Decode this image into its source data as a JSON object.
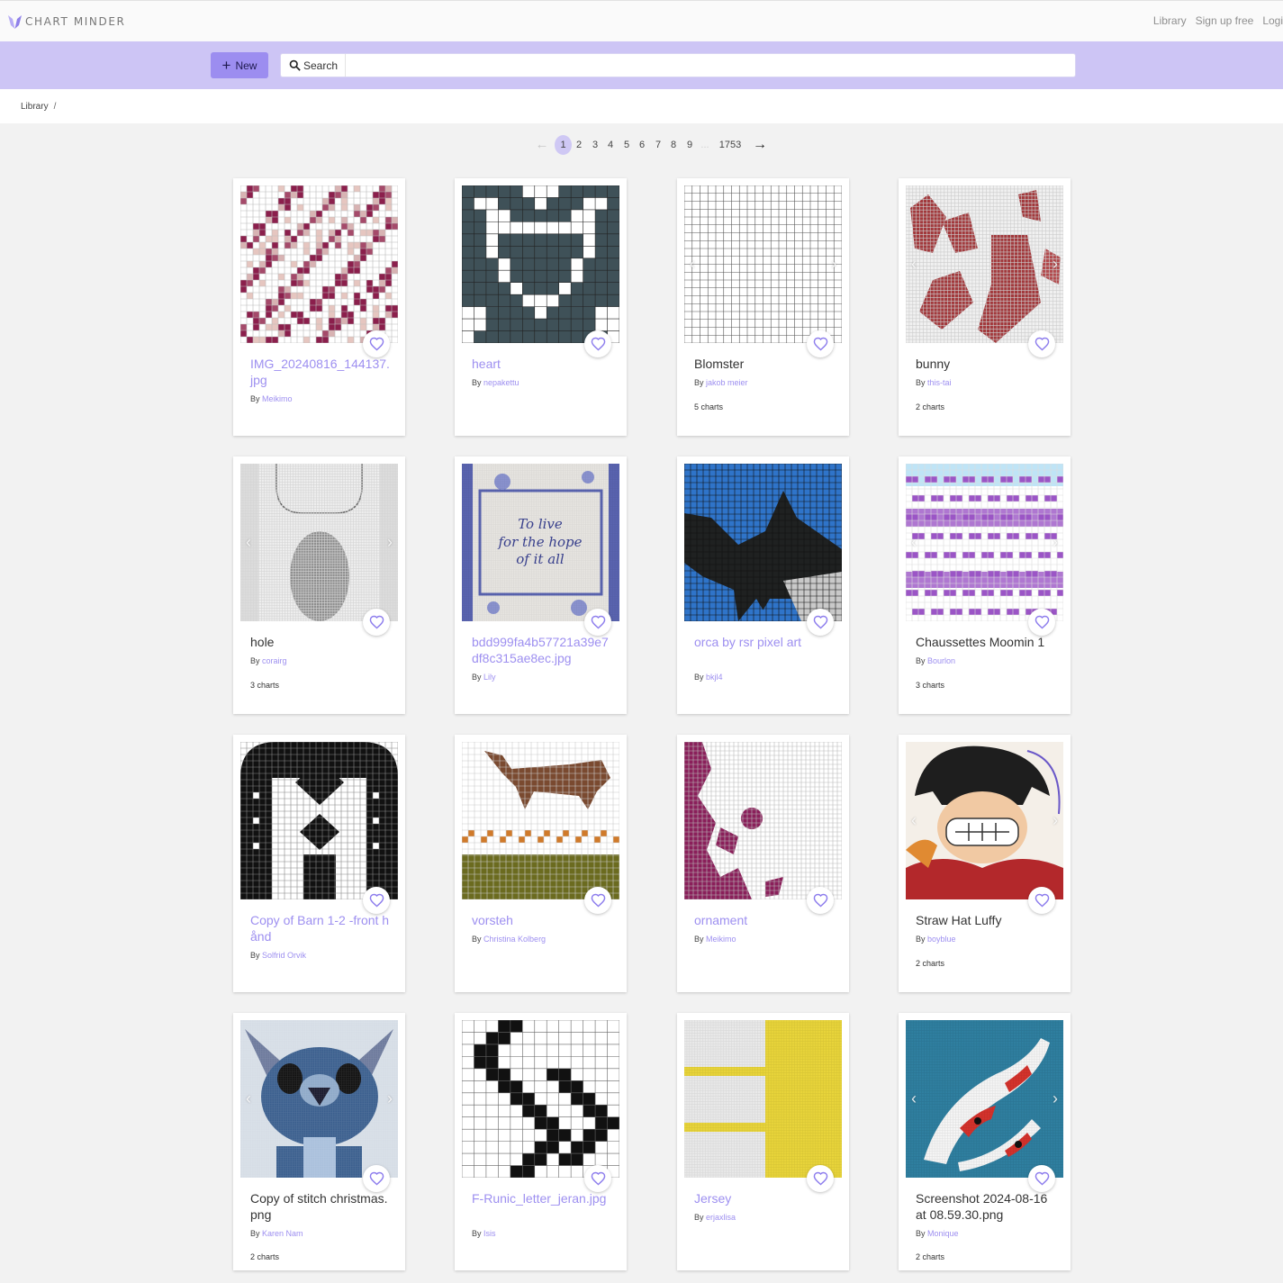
{
  "app": {
    "name": "CHART MINDER"
  },
  "nav": {
    "library": "Library",
    "signup": "Sign up free",
    "login": "Logi"
  },
  "toolbar": {
    "new_label": "New",
    "search_label": "Search",
    "search_value": ""
  },
  "breadcrumb": {
    "root": "Library",
    "sep": "/"
  },
  "pagination": {
    "prev": "←",
    "pages": [
      "1",
      "2",
      "3",
      "4",
      "5",
      "6",
      "7",
      "8",
      "9"
    ],
    "ellipsis": "...",
    "last": "1753",
    "next": "→",
    "current": "1"
  },
  "colors": {
    "accent": "#9c8df0",
    "toolbar_bg": "#cdc5f5",
    "link": "#9d8ff0"
  },
  "cards": [
    {
      "title": "IMG_20240816_144137.jpg",
      "author": "Meikimo",
      "count": "",
      "linked": true
    },
    {
      "title": "heart",
      "author": "nepakettu",
      "count": "",
      "linked": true
    },
    {
      "title": "Blomster",
      "author": "jakob meier",
      "count": "5 charts",
      "linked": false
    },
    {
      "title": "bunny",
      "author": "this-tai",
      "count": "2 charts",
      "linked": false
    },
    {
      "title": "hole",
      "author": "corairg",
      "count": "3 charts",
      "linked": false
    },
    {
      "title": "bdd999fa4b57721a39e7df8c315ae8ec.jpg",
      "author": "Lily",
      "count": "",
      "linked": true
    },
    {
      "title": "orca by rsr pixel art",
      "author": "bkjl4",
      "count": "",
      "linked": true
    },
    {
      "title": "Chaussettes Moomin 1",
      "author": "Bourlon",
      "count": "3 charts",
      "linked": false
    },
    {
      "title": "Copy of Barn 1-2 -front hånd",
      "author": "Solfrid Orvik",
      "count": "",
      "linked": true
    },
    {
      "title": "vorsteh",
      "author": "Christina Kolberg",
      "count": "",
      "linked": true
    },
    {
      "title": "ornament",
      "author": "Meikimo",
      "count": "",
      "linked": true
    },
    {
      "title": "Straw Hat Luffy",
      "author": "boyblue",
      "count": "2 charts",
      "linked": false
    },
    {
      "title": "Copy of stitch christmas.png",
      "author": "Karen Nam",
      "count": "2 charts",
      "linked": false
    },
    {
      "title": "F-Runic_letter_jeran.jpg",
      "author": "Isis",
      "count": "",
      "linked": true
    },
    {
      "title": "Jersey",
      "author": "erjaxlisa",
      "count": "",
      "linked": true
    },
    {
      "title": "Screenshot 2024-08-16 at 08.59.30.png",
      "author": "Monique",
      "count": "2 charts",
      "linked": false
    }
  ],
  "labels": {
    "by": "By"
  }
}
